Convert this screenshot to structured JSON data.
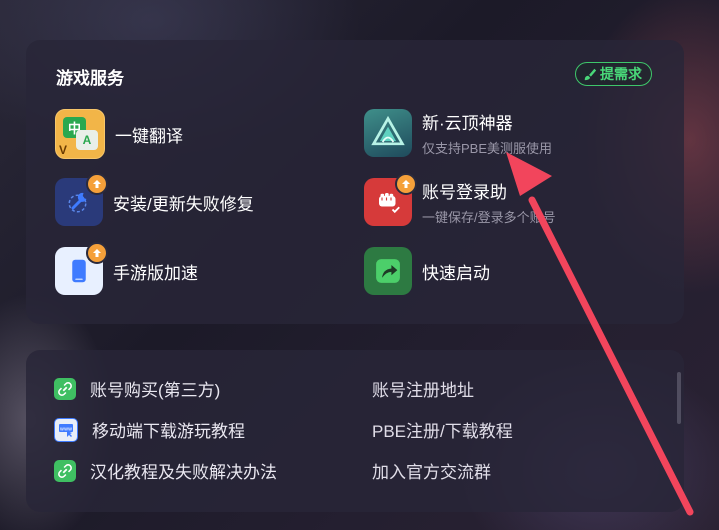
{
  "services": {
    "title": "游戏服务",
    "request_label": "提需求",
    "items": [
      {
        "name": "一键翻译",
        "sub": ""
      },
      {
        "name": "新·云顶神器",
        "sub": "仅支持PBE美测服使用"
      },
      {
        "name": "安装/更新失败修复",
        "sub": ""
      },
      {
        "name": "账号登录助",
        "sub": "一键保存/登录多个账号"
      },
      {
        "name": "手游版加速",
        "sub": ""
      },
      {
        "name": "快速启动",
        "sub": ""
      }
    ],
    "translate_icon_glyphs": {
      "zh": "中",
      "a": "A",
      "v": "V"
    }
  },
  "links": {
    "left": [
      {
        "label": "账号购买(第三方)",
        "icon": "link-icon"
      },
      {
        "label": "移动端下载游玩教程",
        "icon": "www-icon"
      },
      {
        "label": "汉化教程及失败解决办法",
        "icon": "link-icon"
      }
    ],
    "right": [
      {
        "label": "账号注册地址"
      },
      {
        "label": "PBE注册/下载教程"
      },
      {
        "label": "加入官方交流群"
      }
    ]
  },
  "colors": {
    "accent_green": "#3ec76a",
    "badge_orange": "#f5a03a",
    "arrow_red": "#f2455c"
  }
}
